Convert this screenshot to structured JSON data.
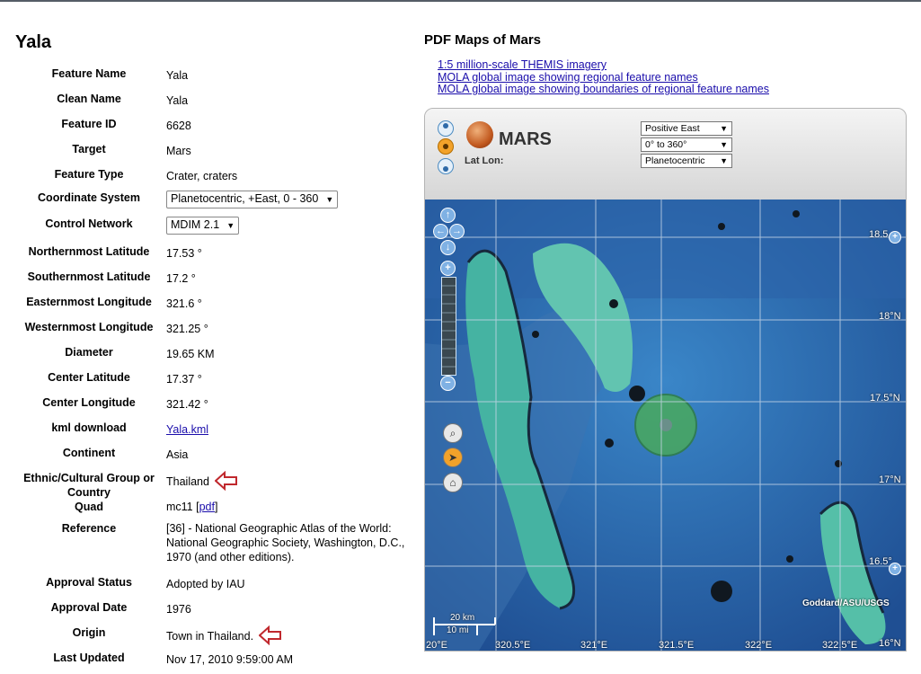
{
  "page": {
    "title": "Yala"
  },
  "attributes": [
    {
      "label": "Feature Name",
      "value": "Yala"
    },
    {
      "label": "Clean Name",
      "value": "Yala"
    },
    {
      "label": "Feature ID",
      "value": "6628"
    },
    {
      "label": "Target",
      "value": "Mars"
    },
    {
      "label": "Feature Type",
      "value": "Crater, craters"
    },
    {
      "label": "Coordinate System",
      "value": "Planetocentric, +East, 0 - 360"
    },
    {
      "label": "Control Network",
      "value": "MDIM 2.1"
    },
    {
      "label": "Northernmost Latitude",
      "value": "17.53 °"
    },
    {
      "label": "Southernmost Latitude",
      "value": "17.2 °"
    },
    {
      "label": "Easternmost Longitude",
      "value": "321.6 °"
    },
    {
      "label": "Westernmost Longitude",
      "value": "321.25 °"
    },
    {
      "label": "Diameter",
      "value": "19.65 KM"
    },
    {
      "label": "Center Latitude",
      "value": "17.37 °"
    },
    {
      "label": "Center Longitude",
      "value": "321.42 °"
    },
    {
      "label": "kml download",
      "value": "Yala.kml"
    },
    {
      "label": "Continent",
      "value": "Asia"
    },
    {
      "label": "Ethnic/Cultural Group or Country",
      "value": "Thailand"
    },
    {
      "label": "Quad",
      "value": "mc11",
      "link": "pdf"
    },
    {
      "label": "Reference",
      "value": "[36] - National Geographic Atlas of the World: National Geographic Society, Washington, D.C., 1970 (and other editions)."
    },
    {
      "label": "Approval Status",
      "value": "Adopted by IAU"
    },
    {
      "label": "Approval Date",
      "value": "1976"
    },
    {
      "label": "Origin",
      "value": "Town in Thailand."
    },
    {
      "label": "Last Updated",
      "value": "Nov 17, 2010 9:59:00 AM"
    }
  ],
  "pdf_maps": {
    "heading": "PDF Maps of Mars",
    "links": [
      "1:5 million-scale THEMIS imagery",
      "MOLA global image showing regional feature names",
      "MOLA global image showing boundaries of regional feature names"
    ]
  },
  "viewer": {
    "planet_label": "MARS",
    "latlon_label": "Lat Lon:",
    "selects": [
      "Positive East",
      "0° to 360°",
      "Planetocentric"
    ],
    "lat_labels": [
      "18.5",
      "18°N",
      "17.5°N",
      "17°N",
      "16.5°",
      "16°N"
    ],
    "lon_labels": [
      "20°E",
      "320.5°E",
      "321°E",
      "321.5°E",
      "322°E",
      "322.5°E"
    ],
    "credit": "Goddard/ASU/USGS",
    "scale_km": "20 km",
    "scale_mi": "10 mi"
  },
  "colors": {
    "link": "#1a0dab",
    "marker": "#c0282d",
    "crater_highlight": "#4caf50"
  }
}
